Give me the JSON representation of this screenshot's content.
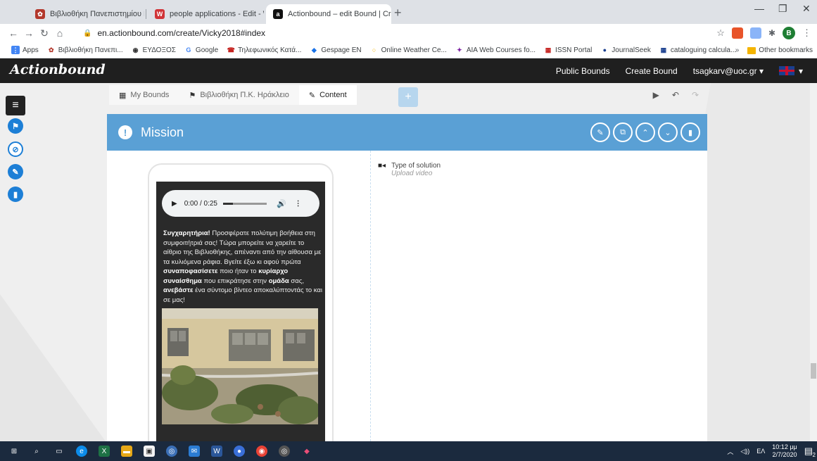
{
  "browser": {
    "tabs": [
      {
        "label": "Βιβλιοθήκη Πανεπιστημίου Κρήτ",
        "active": false
      },
      {
        "label": "people applications - Edit - Word",
        "active": false
      },
      {
        "label": "Actionbound – edit Bound | Crea",
        "active": true
      }
    ],
    "url": "en.actionbound.com/create/Vicky2018#index",
    "profile_initial": "B",
    "bookmarks": [
      "Apps",
      "Βιβλιοθήκη Πανεπι...",
      "ΕΥΔΟΞΟΣ",
      "Google",
      "Τηλεφωνικός Κατά...",
      "Gespage EN",
      "Online Weather Ce...",
      "AIA Web Courses fo...",
      "ISSN Portal",
      "JournalSeek",
      "cataloguing calcula..."
    ],
    "other_bookmarks": "Other bookmarks",
    "overflow": "»"
  },
  "app": {
    "logo": "Actionbound",
    "nav": {
      "public_bounds": "Public Bounds",
      "create_bound": "Create Bound",
      "user": "tsagkarv@uoc.gr"
    }
  },
  "breadcrumb": {
    "my_bounds": "My Bounds",
    "bound_name": "Βιβλιοθήκη Π.Κ. Ηράκλειο",
    "content": "Content"
  },
  "mission": {
    "title": "Mission",
    "audio_time": "0:00 / 0:25",
    "text_parts": [
      {
        "t": "Συγχαρητήρια!",
        "b": true
      },
      {
        "t": " Προσφέρατε πολύτιμη βοήθεια στη συμφοιτήτριά σας! Τώρα μπορείτε να χαρείτε το αίθριο της Βιβλιοθήκης, απέναντι από την αίθουσα με τα κυλιόμενα ράφια. Βγείτε έξω κι αφού πρώτα ",
        "b": false
      },
      {
        "t": "συναποφασίσετε",
        "b": true
      },
      {
        "t": " ποιο ήταν το ",
        "b": false
      },
      {
        "t": "κυρίαρχο συναίσθημα",
        "b": true
      },
      {
        "t": " που επικράτησε στην ",
        "b": false
      },
      {
        "t": "ομάδα",
        "b": true
      },
      {
        "t": " σας, ",
        "b": false
      },
      {
        "t": "ανεβάστε",
        "b": true
      },
      {
        "t": " ένα σύντομο βίντεο αποκαλύπτοντάς το και σε μας!",
        "b": false
      }
    ],
    "solution_label": "Type of solution",
    "solution_value": "Upload video"
  },
  "taskbar": {
    "lang": "ΕΛ",
    "time": "10:12 μμ",
    "date": "2/7/2020",
    "notif_count": "2"
  },
  "colors": {
    "accent": "#5aa0d5",
    "tool_blue": "#1d7fd6",
    "header_dark": "#1f1f1f"
  }
}
